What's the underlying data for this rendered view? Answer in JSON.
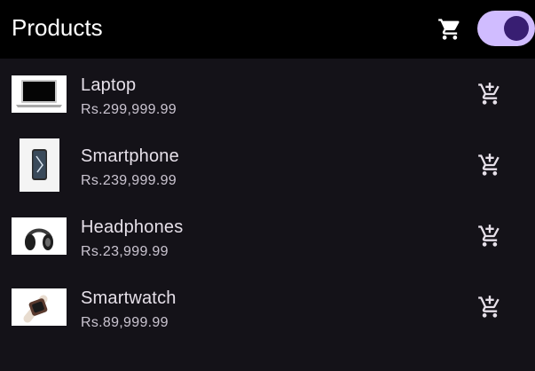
{
  "appbar": {
    "title": "Products",
    "cart_icon": "shopping-cart-icon",
    "theme_toggle": {
      "checked": true,
      "track_color": "#d0bcff",
      "knob_color": "#381e72"
    }
  },
  "colors": {
    "appbar_bg": "#000000",
    "body_bg": "#141218",
    "title_text": "#ffffff",
    "name_text": "#e6e0e9",
    "price_text": "#cac4d0",
    "icon": "#e6e0e9"
  },
  "products": [
    {
      "name": "Laptop",
      "price": "Rs.299,999.99",
      "image": "laptop-image",
      "action_icon": "add-shopping-cart-icon"
    },
    {
      "name": "Smartphone",
      "price": "Rs.239,999.99",
      "image": "smartphone-image",
      "action_icon": "add-shopping-cart-icon"
    },
    {
      "name": "Headphones",
      "price": "Rs.23,999.99",
      "image": "headphones-image",
      "action_icon": "add-shopping-cart-icon"
    },
    {
      "name": "Smartwatch",
      "price": "Rs.89,999.99",
      "image": "smartwatch-image",
      "action_icon": "add-shopping-cart-icon"
    }
  ]
}
